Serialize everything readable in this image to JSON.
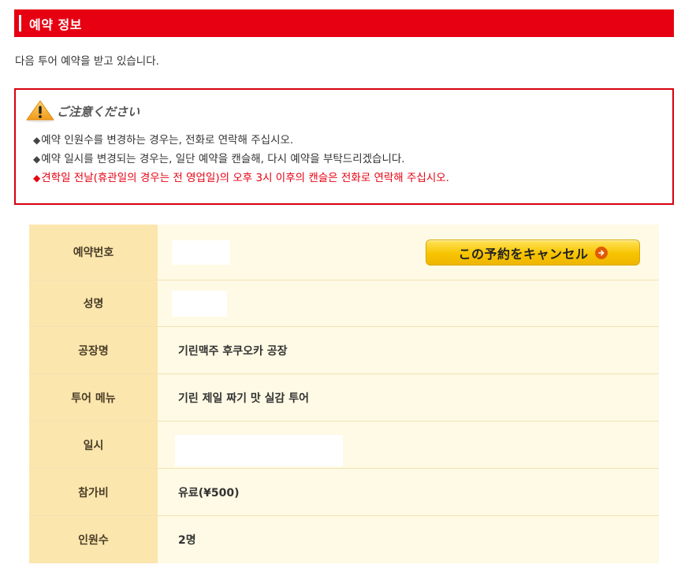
{
  "header": {
    "title": "예약 정보"
  },
  "intro": {
    "text": "다음 투어 예약을 받고 있습니다."
  },
  "notice": {
    "title": "ご注意ください",
    "bullet": "◆",
    "lines": [
      "예약 인원수를 변경하는 경우는, 전화로 연락해 주십시오.",
      "예약 일시를 변경되는 경우는, 일단 예약을 캔슬해, 다시 예약을 부탁드리겠습니다.",
      "견학일 전날(휴관일의 경우는 전 영업일)의 오후 3시 이후의 캔슬은 전화로 연락해 주십시오."
    ]
  },
  "reservation": {
    "rows": [
      {
        "label": "예약번호",
        "value": ""
      },
      {
        "label": "성명",
        "value": ""
      },
      {
        "label": "공장명",
        "value": "기린맥주 후쿠오카 공장"
      },
      {
        "label": "투어 메뉴",
        "value": "기린 제일 짜기 맛 실감 투어"
      },
      {
        "label": "일시",
        "value": ""
      },
      {
        "label": "참가비",
        "value": "유료(¥500)"
      },
      {
        "label": "인원수",
        "value": "2명"
      }
    ],
    "cancel_label": "この予約をキャンセル"
  },
  "colors": {
    "header_red": "#e60012",
    "label_bg": "#fbe6ad",
    "value_bg": "#fefae5",
    "button_yellow": "#f7c400"
  },
  "icons": {
    "notice": "warning-triangle-icon",
    "button": "arrow-right-circle-icon"
  }
}
